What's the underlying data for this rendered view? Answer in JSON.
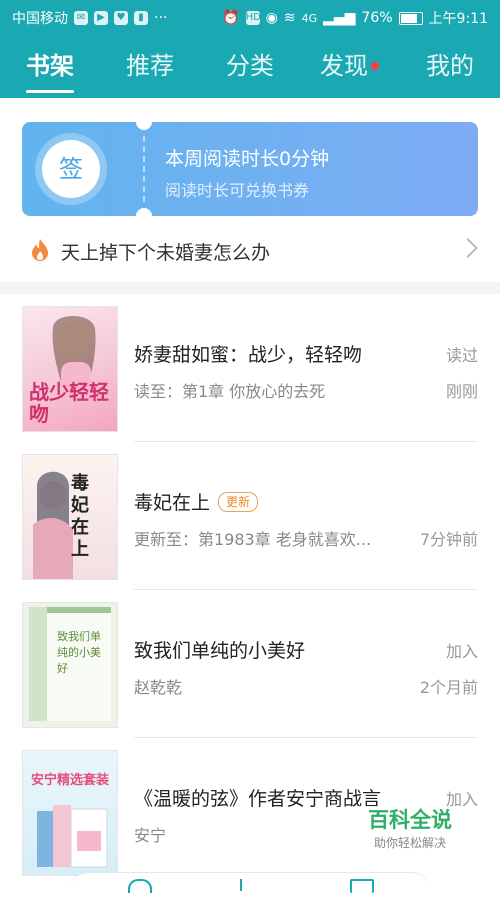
{
  "status_bar": {
    "carrier": "中国移动",
    "signal": "4G",
    "battery": "76%",
    "time": "上午9:11",
    "ellipsis": "···"
  },
  "tabs": [
    {
      "label": "书架",
      "active": true
    },
    {
      "label": "推荐",
      "active": false
    },
    {
      "label": "分类",
      "active": false
    },
    {
      "label": "发现",
      "active": false,
      "has_dot": true
    },
    {
      "label": "我的",
      "active": false
    }
  ],
  "sign_card": {
    "button_label": "签",
    "title": "本周阅读时长0分钟",
    "subtitle": "阅读时长可兑换书券"
  },
  "promo": {
    "icon": "fire-icon",
    "text": "天上掉下个未婚妻怎么办"
  },
  "books": [
    {
      "title": "娇妻甜如蜜：战少，轻轻吻",
      "subtitle": "读至：第1章 你放心的去死",
      "right_top": "读过",
      "right_bottom": "刚刚",
      "cover_text": "战少轻轻吻"
    },
    {
      "title": "毒妃在上",
      "badge": "更新",
      "subtitle": "更新至：第1983章 老身就喜欢...",
      "right_top": "",
      "right_bottom": "7分钟前",
      "cover_text": "毒妃在上"
    },
    {
      "title": "致我们单纯的小美好",
      "subtitle": "赵乾乾",
      "right_top": "加入",
      "right_bottom": "2个月前",
      "cover_text": "致我们单纯的小美好"
    },
    {
      "title": "《温暖的弦》作者安宁商战言",
      "subtitle": "安宁",
      "right_top": "加入",
      "right_bottom": "",
      "cover_text": "安宁精选套装"
    }
  ],
  "watermark": {
    "main": "百科全说",
    "sub": "助你轻松解决"
  },
  "colors": {
    "header": "#1aa9b3",
    "card_gradient_start": "#61b4ee",
    "card_gradient_end": "#7eacf4",
    "badge": "#f08a2a"
  }
}
